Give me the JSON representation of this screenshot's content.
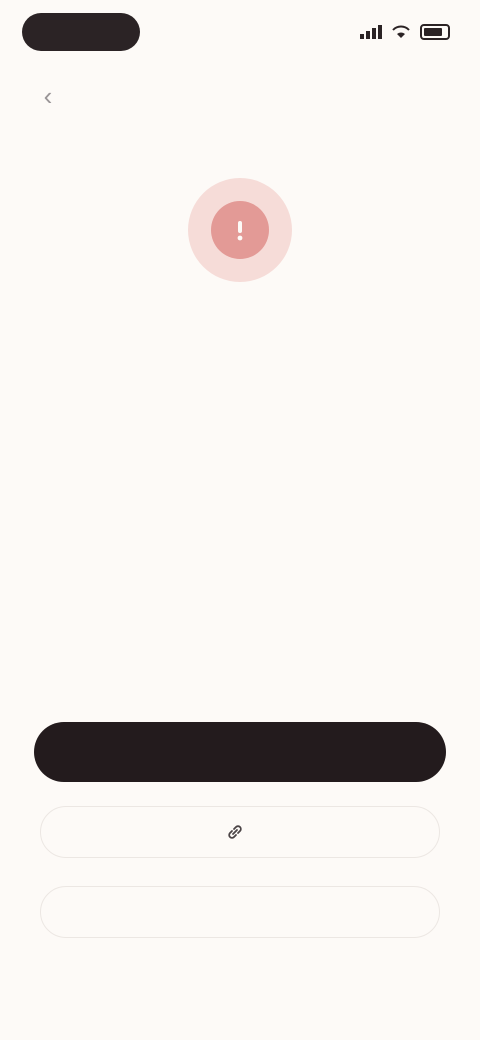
{
  "status_bar": {
    "time": "",
    "icons": [
      "signal-icon",
      "wifi-icon",
      "battery-icon"
    ]
  },
  "nav": {
    "back_icon": "back-arrow-icon"
  },
  "hero": {
    "icon": "alert-icon",
    "title": "",
    "subtitle": ""
  },
  "actions": {
    "primary_label": "",
    "secondary_label": "",
    "secondary_icon": "link-icon",
    "tertiary_label": ""
  },
  "footer": {
    "link_label": ""
  },
  "colors": {
    "background": "#fdfaf7",
    "primary_button": "#231b1d",
    "accent_soft": "#f6dcd8",
    "accent": "#e39a96",
    "tertiary_text": "#7c9fb2"
  }
}
